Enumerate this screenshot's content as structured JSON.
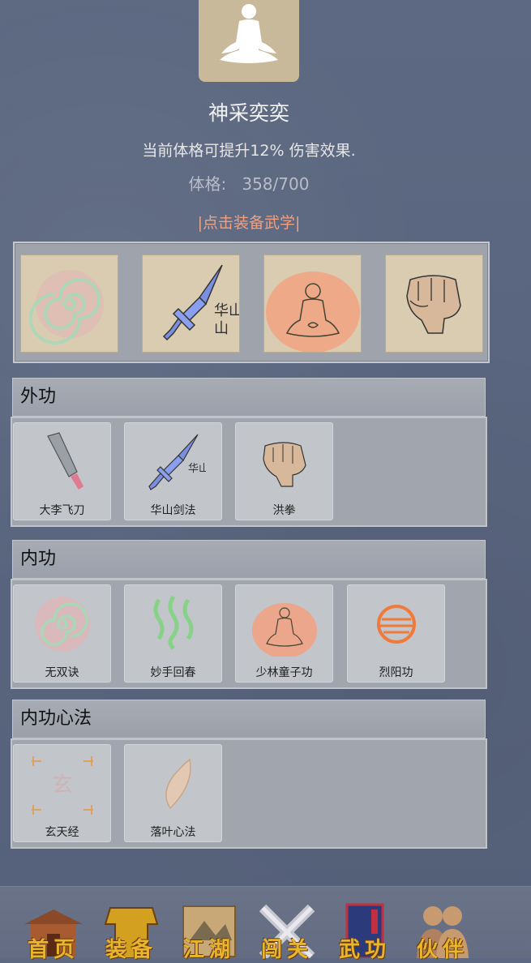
{
  "header": {
    "title": "神采奕奕",
    "description": "当前体格可提升12% 伤害效果.",
    "stat_label": "体格:",
    "stat_value": "358/700",
    "equip_hint": "|点击装备武学|"
  },
  "equipped_slots": [
    {
      "icon": "spiral-icon"
    },
    {
      "icon": "sword-icon",
      "text": "华山"
    },
    {
      "icon": "meditation-icon"
    },
    {
      "icon": "fist-icon"
    }
  ],
  "sections": [
    {
      "title": "外功",
      "items": [
        {
          "label": "大李飞刀",
          "icon": "cleaver-icon"
        },
        {
          "label": "华山剑法",
          "icon": "sword-icon",
          "icon_text": "华山"
        },
        {
          "label": "洪拳",
          "icon": "fist-icon"
        }
      ]
    },
    {
      "title": "内功",
      "items": [
        {
          "label": "无双诀",
          "icon": "spiral-icon"
        },
        {
          "label": "妙手回春",
          "icon": "green-waves-icon"
        },
        {
          "label": "少林童子功",
          "icon": "meditation-icon"
        },
        {
          "label": "烈阳功",
          "icon": "fire-orb-icon"
        }
      ]
    },
    {
      "title": "内功心法",
      "items": [
        {
          "label": "玄天经",
          "icon": "xuan-seal-icon",
          "icon_text": "玄"
        },
        {
          "label": "落叶心法",
          "icon": "leaf-icon"
        }
      ]
    }
  ],
  "bottom_nav": [
    {
      "label": "首页",
      "icon": "house-icon"
    },
    {
      "label": "装备",
      "icon": "armor-icon"
    },
    {
      "label": "江湖",
      "icon": "scroll-map-icon"
    },
    {
      "label": "闯关",
      "icon": "crossed-swords-icon"
    },
    {
      "label": "武功",
      "icon": "book-icon"
    },
    {
      "label": "伙伴",
      "icon": "companions-icon"
    }
  ],
  "colors": {
    "background": "#5b6780",
    "equip_hint": "#f0a080",
    "nav_text": "#e9b52a"
  }
}
